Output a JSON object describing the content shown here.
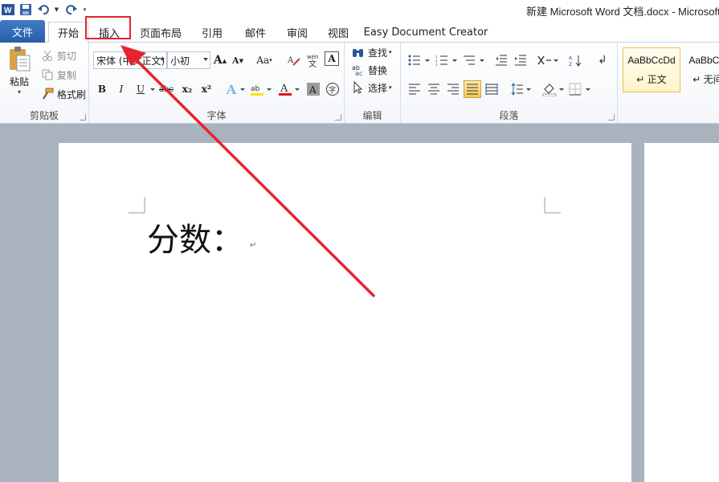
{
  "window": {
    "title": "新建 Microsoft Word 文档.docx - Microsoft Word"
  },
  "qat": {
    "app_icon": "word-icon",
    "save_icon": "save-icon",
    "undo_icon": "undo-icon",
    "redo_icon": "redo-icon",
    "customize_icon": "customize-qat-icon"
  },
  "tabs": {
    "file": "文件",
    "home": "开始",
    "insert": "插入",
    "page_layout": "页面布局",
    "references": "引用",
    "mailings": "邮件",
    "review": "审阅",
    "view": "视图",
    "addin": "Easy Document Creator"
  },
  "clipboard": {
    "paste": "粘贴",
    "cut": "剪切",
    "copy": "复制",
    "format_painter": "格式刷",
    "label": "剪贴板"
  },
  "font": {
    "font_name": "宋体 (中文正文)",
    "font_size": "小初",
    "bold": "B",
    "italic": "I",
    "underline": "U",
    "strike": "abc",
    "subscript": "x₂",
    "superscript": "x²",
    "change_case": "Aa",
    "label": "字体"
  },
  "editing": {
    "find": "查找",
    "replace": "替换",
    "select": "选择",
    "label": "编辑"
  },
  "paragraph": {
    "label": "段落"
  },
  "styles": {
    "items": [
      {
        "sample": "AaBbCcDd",
        "name": "正文"
      },
      {
        "sample": "AaBbCcDd",
        "name": "无间隔"
      }
    ]
  },
  "document": {
    "text": "分数："
  },
  "colors": {
    "file_tab": "#2a5ea8",
    "highlight": "#e8232f",
    "arrow": "#e8232f"
  }
}
